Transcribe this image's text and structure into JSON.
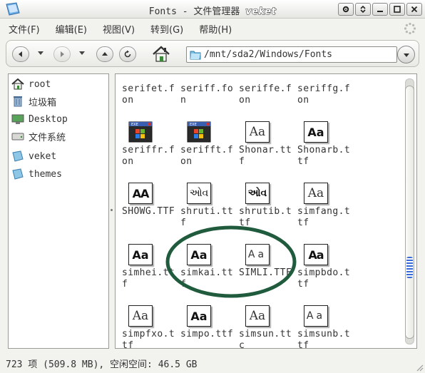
{
  "window": {
    "title_prefix": "Fonts  -  文件管理器",
    "title_brand": "veket"
  },
  "menu": [
    {
      "label": "文件(F)"
    },
    {
      "label": "编辑(E)"
    },
    {
      "label": "视图(V)"
    },
    {
      "label": "转到(G)"
    },
    {
      "label": "帮助(H)"
    }
  ],
  "location": {
    "path": "/mnt/sda2/Windows/Fonts"
  },
  "sidebar": {
    "items": [
      {
        "label": "root",
        "icon": "home-icon"
      },
      {
        "label": "垃圾箱",
        "icon": "trash-icon"
      },
      {
        "label": "Desktop",
        "icon": "desktop-icon"
      },
      {
        "label": "文件系统",
        "icon": "filesystem-icon"
      },
      {
        "label": "veket",
        "icon": "drive-icon"
      },
      {
        "label": "themes",
        "icon": "drive-icon"
      }
    ]
  },
  "files": [
    {
      "name": "serifet.fon",
      "icon": "none"
    },
    {
      "name": "seriff.fon",
      "icon": "none"
    },
    {
      "name": "seriffe.fon",
      "icon": "none"
    },
    {
      "name": "seriffg.fon",
      "icon": "none"
    },
    {
      "name": "seriffr.fon",
      "icon": "exe-icon"
    },
    {
      "name": "serifft.fon",
      "icon": "exe-icon"
    },
    {
      "name": "Shonar.ttf",
      "icon": "font-icon",
      "glyph": "Aa",
      "style": "light"
    },
    {
      "name": "Shonarb.ttf",
      "icon": "font-icon",
      "glyph": "Aa",
      "style": "bold"
    },
    {
      "name": "SHOWG.TTF",
      "icon": "font-icon",
      "glyph": "AA",
      "style": "heavy"
    },
    {
      "name": "shruti.ttf",
      "icon": "font-icon",
      "glyph": "ઓવ",
      "style": "guj"
    },
    {
      "name": "shrutib.ttf",
      "icon": "font-icon",
      "glyph": "ઓવ",
      "style": "guj-bold"
    },
    {
      "name": "simfang.ttf",
      "icon": "font-icon",
      "glyph": "Aa",
      "style": "light"
    },
    {
      "name": "simhei.ttf",
      "icon": "font-icon",
      "glyph": "Aa",
      "style": "bold"
    },
    {
      "name": "simkai.ttf",
      "icon": "font-icon",
      "glyph": "Aa",
      "style": "bold"
    },
    {
      "name": "SIMLI.TTF",
      "icon": "font-icon",
      "glyph": "Aa",
      "style": "thin"
    },
    {
      "name": "simpbdo.ttf",
      "icon": "font-icon",
      "glyph": "Aa",
      "style": "heavy"
    },
    {
      "name": "simpfxo.ttf",
      "icon": "font-icon",
      "glyph": "Aa",
      "style": "light"
    },
    {
      "name": "simpo.ttf",
      "icon": "font-icon",
      "glyph": "Aa",
      "style": "bold"
    },
    {
      "name": "simsun.ttc",
      "icon": "font-icon",
      "glyph": "Aa",
      "style": "light"
    },
    {
      "name": "simsunb.ttf",
      "icon": "font-icon",
      "glyph": "Aa",
      "style": "thin"
    }
  ],
  "status": {
    "text": "723 项 (509.8 MB), 空闲空间: 46.5 GB"
  },
  "colors": {
    "annotation": "#1f5b3c",
    "scroll_grip": "#3a6ad6"
  }
}
